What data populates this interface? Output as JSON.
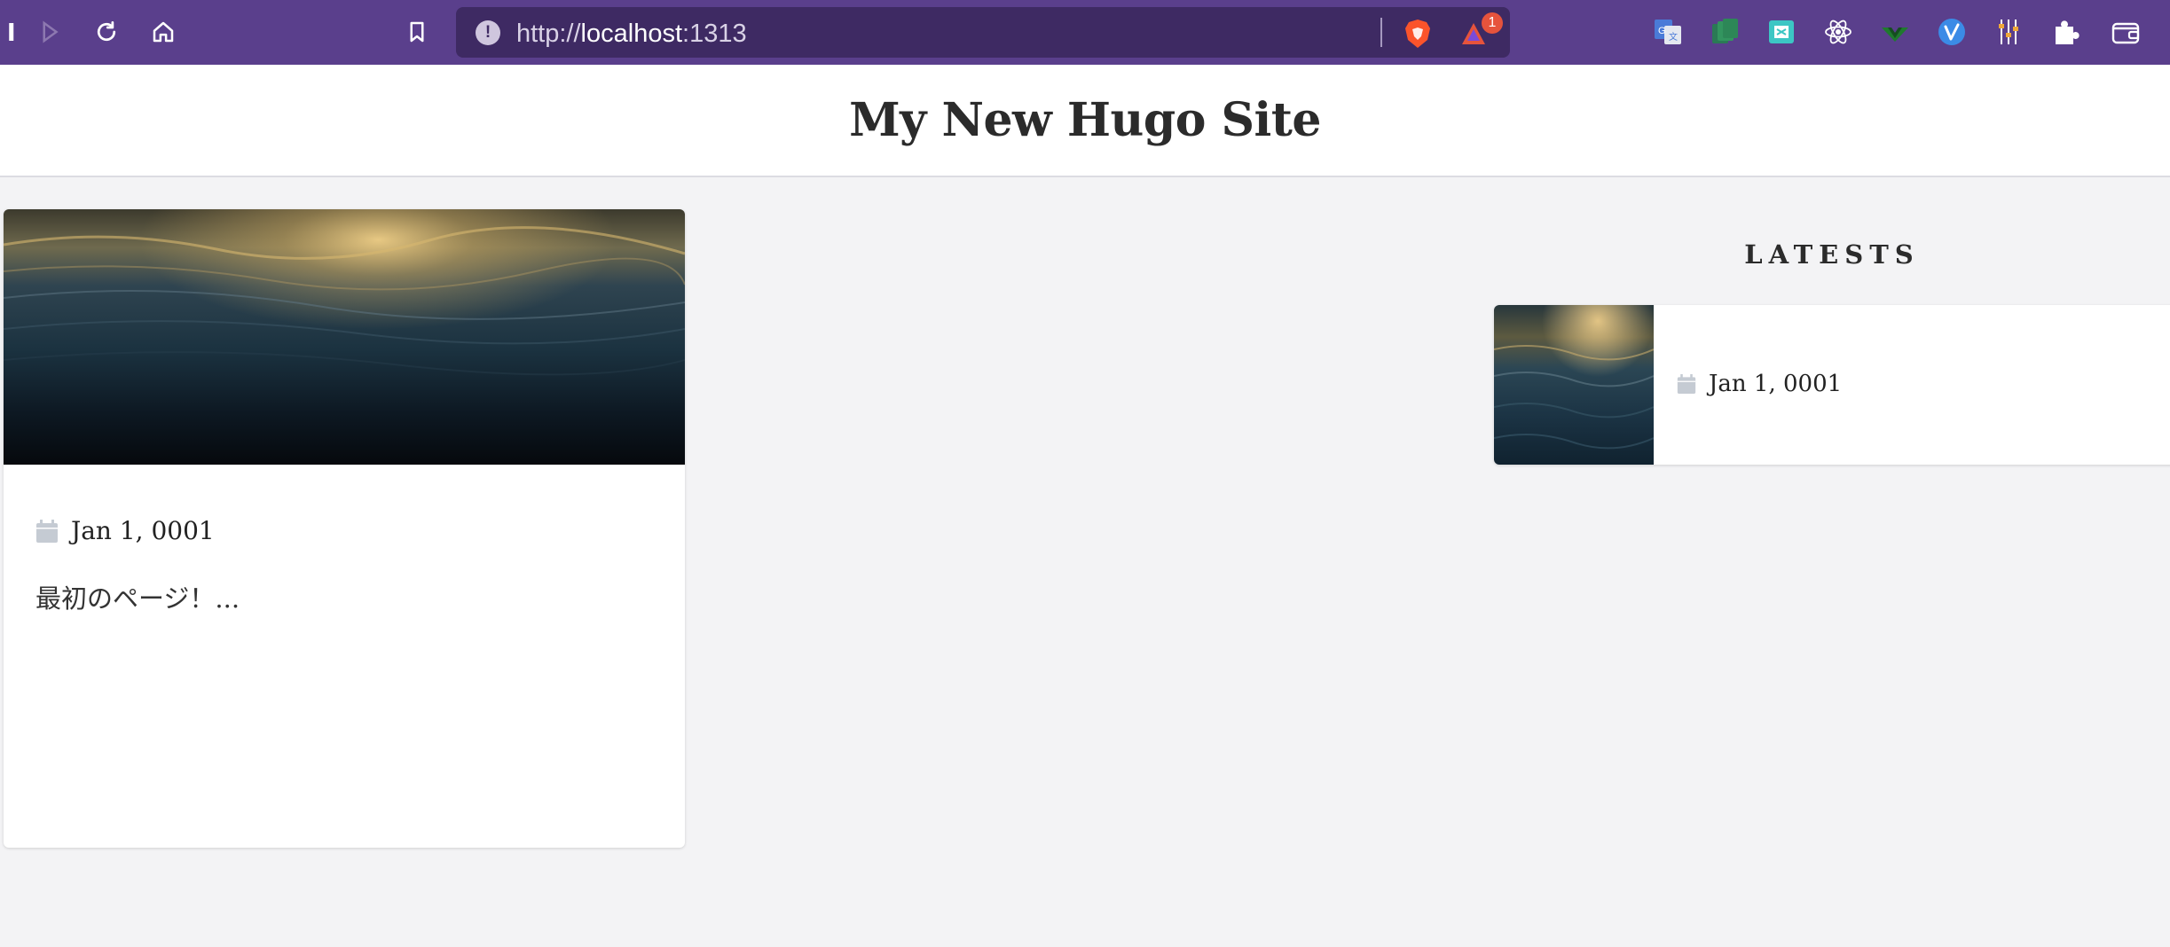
{
  "browser": {
    "url_scheme": "http://",
    "url_host": "localhost",
    "url_port": ":1313",
    "rewards_badge": "1",
    "nav_icons": [
      "back-icon",
      "forward-icon",
      "reload-icon",
      "home-icon",
      "bookmark-icon"
    ],
    "extension_icons": [
      "google-translate-icon",
      "stacks-icon",
      "screen-capture-icon",
      "react-devtools-icon",
      "vue-devtools-icon",
      "vimium-icon",
      "mixer-icon",
      "puzzle-icon",
      "wallet-icon"
    ]
  },
  "site": {
    "title": "My New Hugo Site"
  },
  "post": {
    "date": "Jan 1, 0001",
    "summary": "最初のページ！..."
  },
  "sidebar": {
    "heading": "LATESTS",
    "items": [
      {
        "date": "Jan 1, 0001"
      }
    ]
  },
  "colors": {
    "toolbar": "#5a3f8c",
    "urlbar": "#3e2a63",
    "page_bg": "#f3f3f5",
    "calendar_icon": "#c5cbd3",
    "rewards_badge": "#e6533c"
  }
}
